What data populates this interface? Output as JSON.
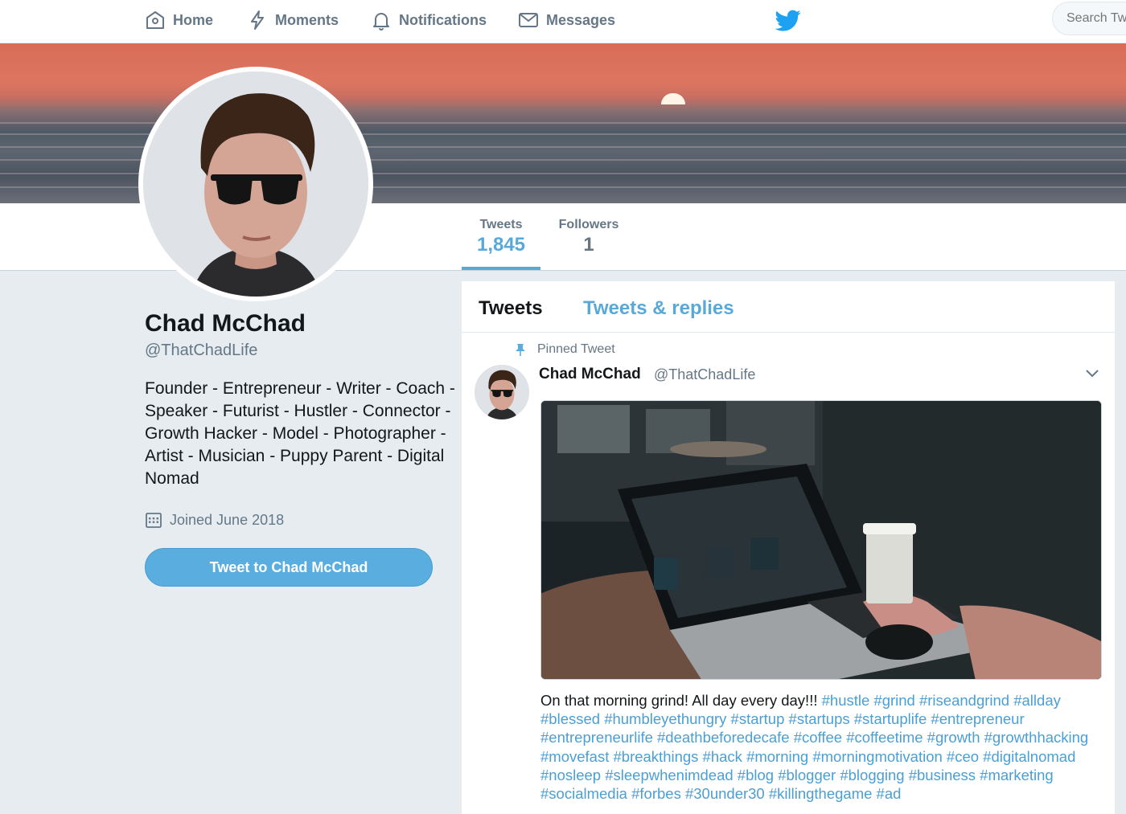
{
  "nav": {
    "home": "Home",
    "moments": "Moments",
    "notifications": "Notifications",
    "messages": "Messages",
    "logo_icon": "twitter-bird-icon",
    "search_placeholder": "Search Twitter"
  },
  "profile": {
    "name": "Chad McChad",
    "handle": "@ThatChadLife",
    "bio": "Founder - Entrepreneur - Writer - Coach - Speaker - Futurist - Hustler - Connector - Growth Hacker - Model - Photographer - Artist - Musician - Puppy Parent - Digital Nomad",
    "joined": "Joined June 2018",
    "tweet_to_label": "Tweet to Chad McChad"
  },
  "stats": {
    "tweets_label": "Tweets",
    "tweets_value": "1,845",
    "followers_label": "Followers",
    "followers_value": "1"
  },
  "timeline": {
    "tab_tweets": "Tweets",
    "tab_replies": "Tweets & replies",
    "pinned_label": "Pinned Tweet",
    "tweet": {
      "author_name": "Chad McChad",
      "author_handle": "@ThatChadLife",
      "text": "On that morning grind! All day every day!!!",
      "hashtags": "#hustle #grind #riseandgrind #allday #blessed #humbleyethungry #startup #startups #startuplife #entrepreneur #entrepreneurlife #deathbeforedecafe #coffee #coffeetime #growth #growthhacking #movefast #breakthings #hack #morning #morningmotivation #ceo #digitalnomad #nosleep #sleepwhenimdead #blog #blogger #blogging #business #marketing #socialmedia #forbes #30under30 #killingthegame #ad"
    }
  },
  "colors": {
    "accent": "#58a9d8",
    "button": "#5aaedf",
    "hashtag": "#4a9fd4",
    "page_bg": "#e6ecf0"
  }
}
